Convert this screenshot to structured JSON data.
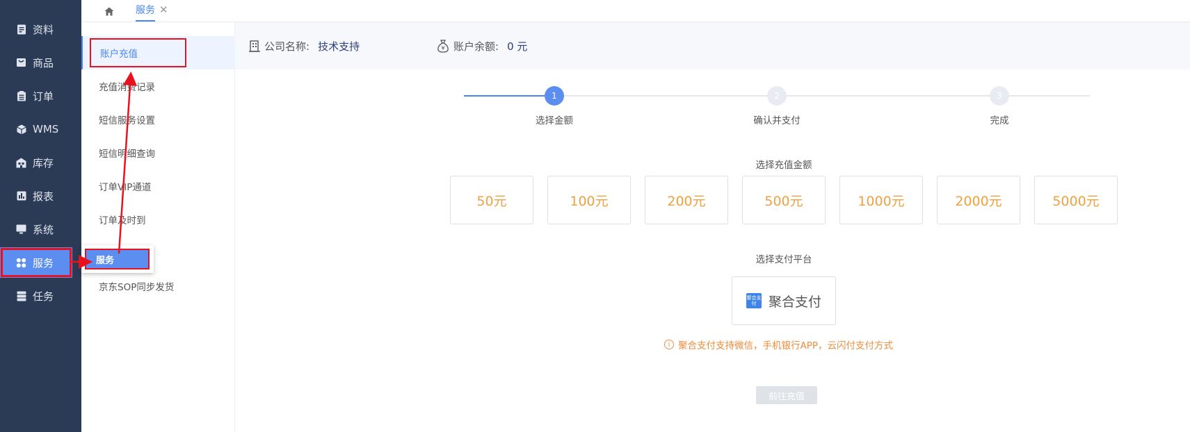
{
  "sidebar": {
    "items": [
      {
        "label": "资料",
        "icon": "document-icon"
      },
      {
        "label": "商品",
        "icon": "shop-icon"
      },
      {
        "label": "订单",
        "icon": "clipboard-icon"
      },
      {
        "label": "WMS",
        "icon": "cube-icon"
      },
      {
        "label": "库存",
        "icon": "warehouse-icon"
      },
      {
        "label": "报表",
        "icon": "bar-chart-icon"
      },
      {
        "label": "系统",
        "icon": "monitor-icon"
      },
      {
        "label": "服务",
        "icon": "grid-icon"
      },
      {
        "label": "任务",
        "icon": "server-icon"
      }
    ],
    "active": "服务"
  },
  "tabs": {
    "home_icon": "home-icon",
    "active_tab": "服务"
  },
  "submenu": {
    "items": [
      "账户充值",
      "充值消费记录",
      "短信服务设置",
      "短信明细查询",
      "订单VIP通道",
      "订单及时到",
      "",
      "京东SOP同步发货"
    ],
    "active": "账户充值"
  },
  "popup": {
    "label": "服务"
  },
  "info": {
    "company_label": "公司名称:",
    "company_value": "技术支持",
    "balance_label": "账户余额:",
    "balance_value": "0 元"
  },
  "steps": [
    {
      "num": "1",
      "label": "选择金额"
    },
    {
      "num": "2",
      "label": "确认并支付"
    },
    {
      "num": "3",
      "label": "完成"
    }
  ],
  "amount_title": "选择充值金额",
  "amounts": [
    "50元",
    "100元",
    "200元",
    "500元",
    "1000元",
    "2000元",
    "5000元"
  ],
  "pay_title": "选择支付平台",
  "pay_option": {
    "label": "聚合支付",
    "logo_text": "聚合支付"
  },
  "tip": "聚合支付支持微信，手机银行APP，云闪付支付方式",
  "submit_label": "前往充值",
  "colors": {
    "sidebar": "#2b3a55",
    "accent": "#4a86f0",
    "amount": "#f0a040",
    "highlight": "#e8121f"
  }
}
